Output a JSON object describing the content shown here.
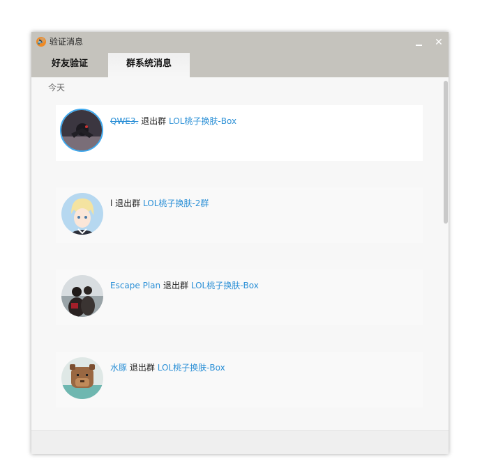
{
  "window": {
    "title": "验证消息",
    "title_icon": "speaker-icon",
    "minimize_glyph": "",
    "close_glyph": "✕"
  },
  "tabs": [
    {
      "label": "好友验证",
      "active": false
    },
    {
      "label": "群系统消息",
      "active": true
    }
  ],
  "date_label": "今天",
  "messages": [
    {
      "user": "QWE3.",
      "user_style": "strikethrough",
      "action": "退出群",
      "group": "LOL桃子换肤-Box",
      "avatar": "dark-drawing-avatar"
    },
    {
      "user": "l",
      "user_style": "plain",
      "action": "退出群",
      "group": "LOL桃子换肤-2群",
      "avatar": "anime-blond-avatar"
    },
    {
      "user": "Escape Plan",
      "user_style": "link",
      "action": "退出群",
      "group": "LOL桃子换肤-Box",
      "avatar": "couple-photo-avatar"
    },
    {
      "user": "水豚",
      "user_style": "link",
      "action": "退出群",
      "group": "LOL桃子换肤-Box",
      "avatar": "capybara-avatar"
    }
  ],
  "colors": {
    "titlebar": "#c5c3bd",
    "link": "#2a8fd6",
    "avatar_ring": "#3da8ee"
  }
}
